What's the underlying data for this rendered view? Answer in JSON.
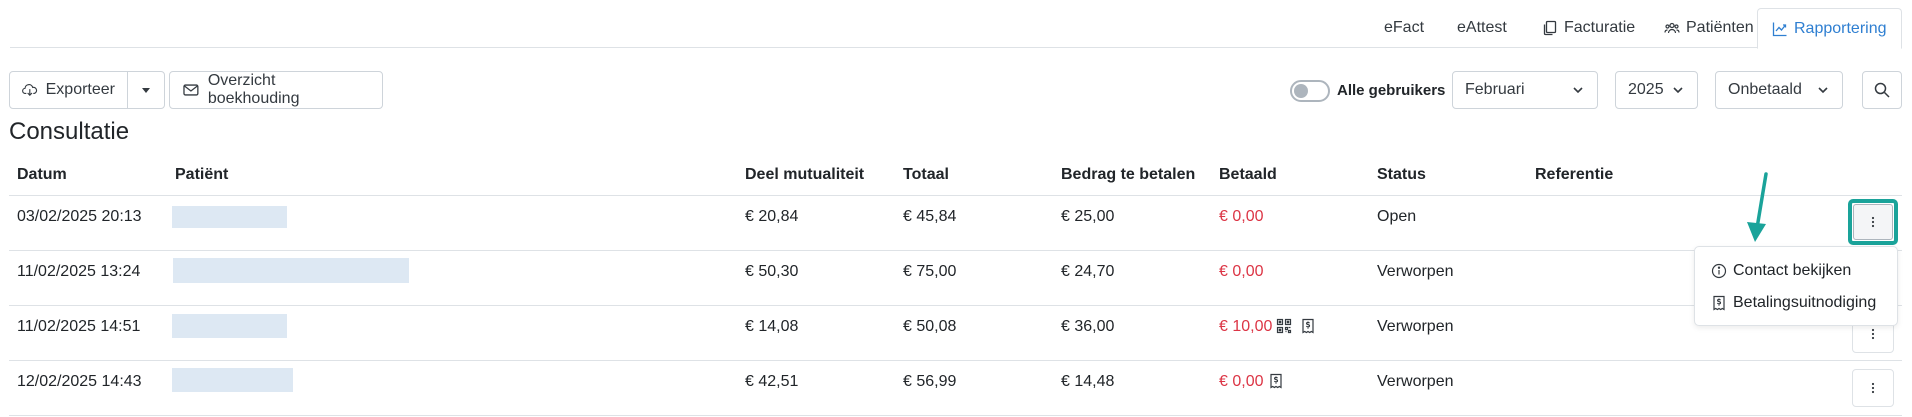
{
  "tabs": [
    {
      "label": "eFact",
      "icon": ""
    },
    {
      "label": "eAttest",
      "icon": ""
    },
    {
      "label": "Facturatie",
      "icon": "copy-icon"
    },
    {
      "label": "Patiënten",
      "icon": "people-icon"
    },
    {
      "label": "Rapportering",
      "icon": "chart-line-icon",
      "active": true
    }
  ],
  "toolbar": {
    "export_label": "Exporteer",
    "overview_label": "Overzicht boekhouding",
    "all_users_label": "Alle gebruikers",
    "all_users_on": false,
    "month": "Februari",
    "year": "2025",
    "payment_filter": "Onbetaald"
  },
  "section_title": "Consultatie",
  "table": {
    "headers": [
      "Datum",
      "Patiënt",
      "Deel mutualiteit",
      "Totaal",
      "Bedrag te betalen",
      "Betaald",
      "Status",
      "Referentie"
    ],
    "rows": [
      {
        "datum": "03/02/2025 20:13",
        "deel": "€ 20,84",
        "totaal": "€ 45,84",
        "bedrag": "€ 25,00",
        "betaald": "€ 0,00",
        "status": "Open",
        "referentie": ""
      },
      {
        "datum": "11/02/2025 13:24",
        "deel": "€ 50,30",
        "totaal": "€ 75,00",
        "bedrag": "€ 24,70",
        "betaald": "€ 0,00",
        "status": "Verworpen",
        "referentie": ""
      },
      {
        "datum": "11/02/2025 14:51",
        "deel": "€ 14,08",
        "totaal": "€ 50,08",
        "bedrag": "€ 36,00",
        "betaald": "€ 10,00",
        "status": "Verworpen",
        "referentie": ""
      },
      {
        "datum": "12/02/2025 14:43",
        "deel": "€ 42,51",
        "totaal": "€ 56,99",
        "bedrag": "€ 14,48",
        "betaald": "€ 0,00",
        "status": "Verworpen",
        "referentie": ""
      }
    ]
  },
  "dropdown": {
    "items": [
      {
        "label": "Contact bekijken",
        "icon": "info-circle-icon"
      },
      {
        "label": "Betalingsuitnodiging",
        "icon": "invoice-icon"
      }
    ]
  },
  "colors": {
    "accent": "#2f7fd1",
    "unpaid": "#dc3545",
    "highlight": "#1aa39a",
    "redacted": "#dde8f3"
  }
}
